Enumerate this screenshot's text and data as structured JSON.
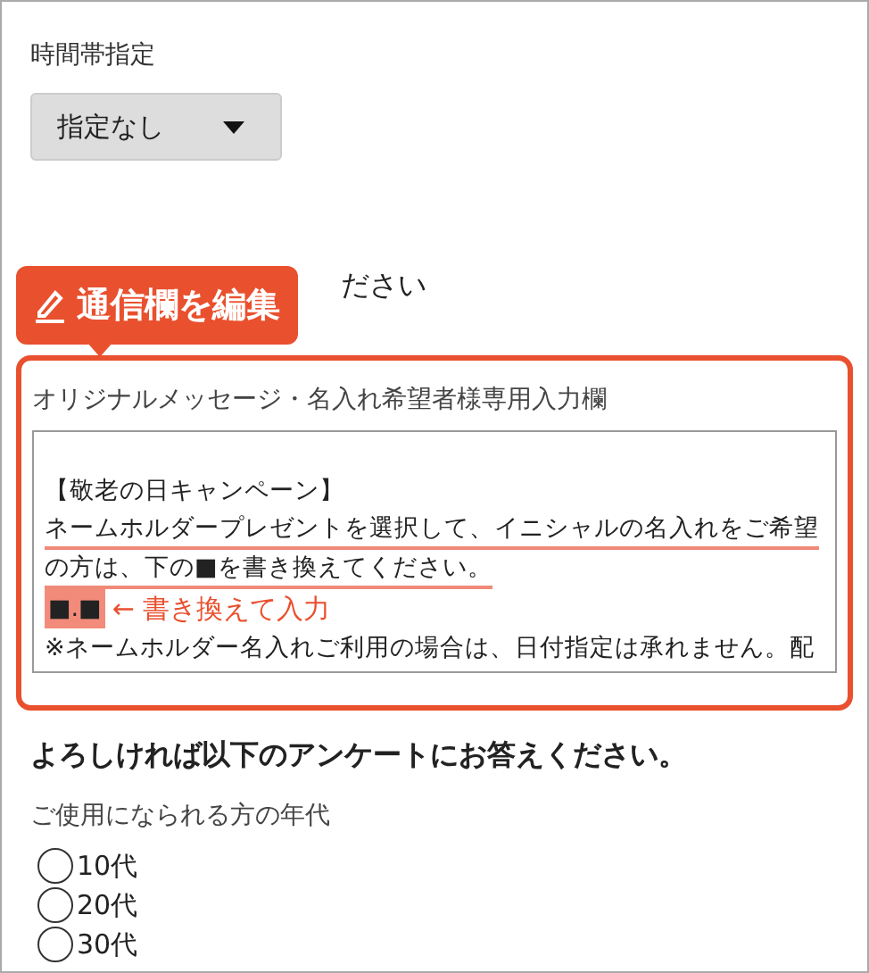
{
  "time_slot": {
    "label": "時間帯指定",
    "dropdown": {
      "value": "指定なし"
    }
  },
  "hidden_heading": {
    "visible_text": "ださい"
  },
  "badge": {
    "label": "通信欄を編集"
  },
  "message_field": {
    "label": "オリジナルメッセージ・名入れ希望者様専用入力欄",
    "lines": [
      {
        "kind": "blank"
      },
      {
        "kind": "plain",
        "text": "【敬老の日キャンペーン】"
      },
      {
        "kind": "underlined",
        "text": "ネームホルダープレゼントを選択して、イニシャルの名入れをご希望"
      },
      {
        "kind": "underlined",
        "text": "の方は、下の■を書き換えてください。"
      },
      {
        "kind": "highlighted",
        "text": "■.■",
        "annotation": "← 書き換えて入力"
      },
      {
        "kind": "plain",
        "text": "※ネームホルダー名入れご利用の場合は、日付指定は承れません。配"
      }
    ]
  },
  "survey": {
    "heading": "よろしければ以下のアンケートにお答えください。",
    "question": "ご使用になられる方の年代",
    "options": [
      {
        "label": "10代",
        "selected": false
      },
      {
        "label": "20代",
        "selected": false
      },
      {
        "label": "30代",
        "selected": false
      }
    ]
  }
}
